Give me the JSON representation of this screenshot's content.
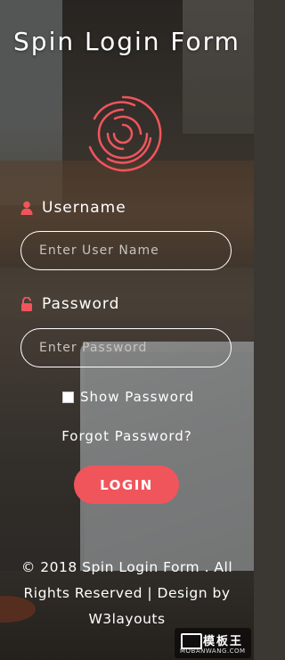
{
  "form": {
    "title": "Spin Login Form",
    "username_label": "Username",
    "username_placeholder": "Enter User Name",
    "password_label": "Password",
    "password_placeholder": "Enter Password",
    "show_password_label": "Show Password",
    "forgot_password": "Forgot Password?",
    "login_button": "LOGIN"
  },
  "footer": {
    "text": "© 2018 Spin Login Form . All Rights Reserved | Design by",
    "link": "W3layouts"
  },
  "watermark": {
    "cn": "模板王",
    "en": "MOBANWANG.COM"
  },
  "icons": {
    "user": "user-icon",
    "lock": "lock-icon",
    "spinner": "spinner-logo-icon"
  },
  "colors": {
    "accent": "#f0555c",
    "text": "#ffffff"
  }
}
